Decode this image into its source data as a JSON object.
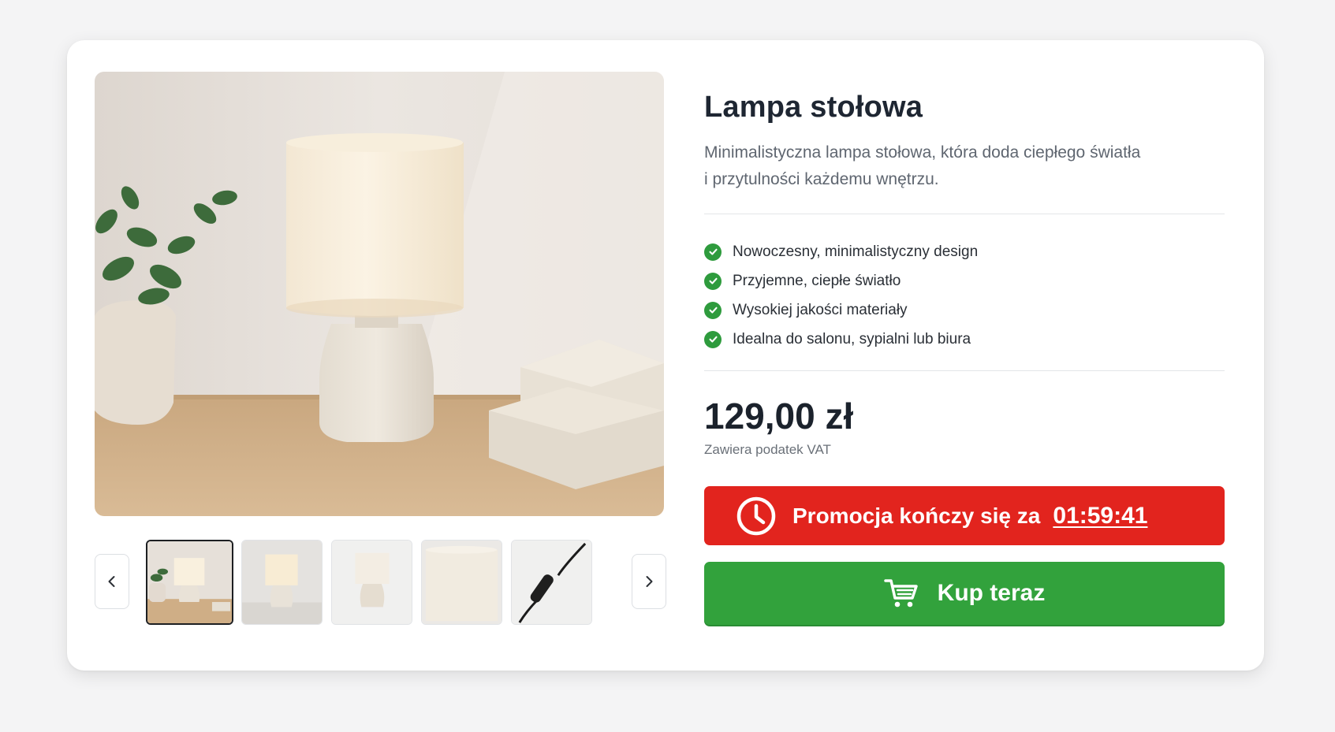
{
  "product": {
    "title": "Lampa stołowa",
    "description": "Minimalistyczna lampa stołowa, która doda ciepłego światła i przytulności każdemu wnętrzu.",
    "features": [
      "Nowoczesny, minimalistyczny design",
      "Przyjemne, ciepłe światło",
      "Wysokiej jakości materiały",
      "Idealna do salonu, sypialni lub biura"
    ],
    "price": "129,00 zł",
    "vat_note": "Zawiera podatek VAT"
  },
  "promo": {
    "label": "Promocja kończy się za",
    "timer": "01:59:41",
    "color": "#e2241e"
  },
  "cta": {
    "label": "Kup teraz",
    "icon": "cart-icon",
    "color": "#32a23c"
  },
  "gallery": {
    "selected_index": 0,
    "thumbnails": [
      "lamp-on-desk",
      "lamp-front",
      "lamp-product",
      "lampshade-closeup",
      "switch-cable"
    ]
  },
  "icons": {
    "feature_check": "check-icon",
    "prev": "chevron-left-icon",
    "next": "chevron-right-icon",
    "promo": "clock-icon"
  }
}
